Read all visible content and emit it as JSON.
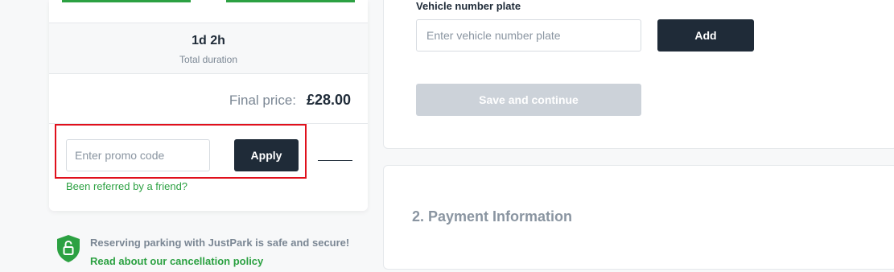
{
  "summary": {
    "duration_value": "1d 2h",
    "duration_label": "Total duration",
    "final_price_label": "Final price:",
    "final_price_value": "£28.00"
  },
  "promo": {
    "placeholder": "Enter promo code",
    "apply_label": "Apply",
    "referred_link": "Been referred by a friend?"
  },
  "secure_note": {
    "text": "Reserving parking with JustPark is safe and secure!",
    "cancellation_link": "Read about our cancellation policy",
    "icon": "shield-lock-icon"
  },
  "vehicle": {
    "label": "Vehicle number plate",
    "placeholder": "Enter vehicle number plate",
    "add_label": "Add",
    "save_label": "Save and continue"
  },
  "payment": {
    "title": "2. Payment Information"
  },
  "colors": {
    "brand_green": "#2ca142",
    "dark_button": "#1f2b38",
    "disabled_button": "#ccd2d9",
    "highlight": "#e0101c"
  }
}
